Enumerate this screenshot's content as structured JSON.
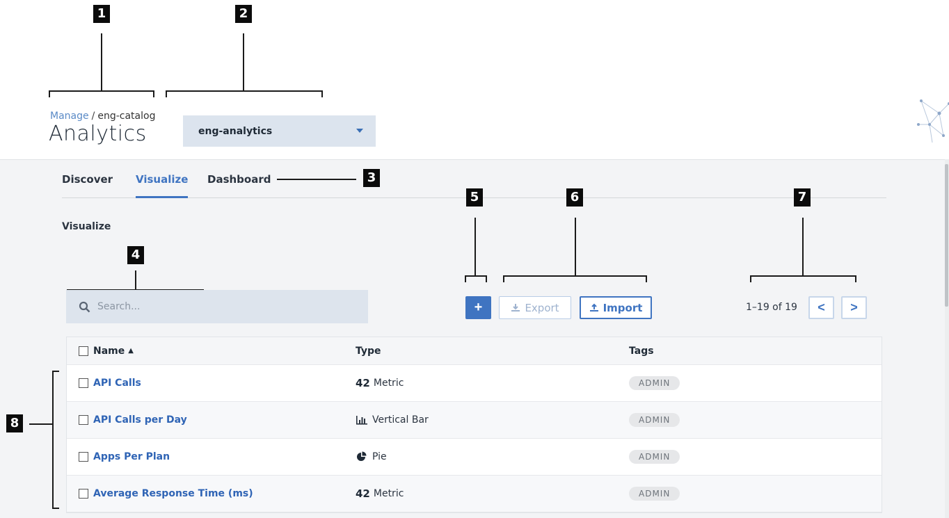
{
  "callouts": [
    "1",
    "2",
    "3",
    "4",
    "5",
    "6",
    "7",
    "8"
  ],
  "header": {
    "breadcrumb_link": "Manage",
    "breadcrumb_sep": "/",
    "breadcrumb_current": "eng-catalog",
    "title": "Analytics",
    "space_selector": "eng-analytics"
  },
  "tabs": [
    {
      "label": "Discover",
      "active": false
    },
    {
      "label": "Visualize",
      "active": true
    },
    {
      "label": "Dashboard",
      "active": false
    }
  ],
  "section_title": "Visualize",
  "search": {
    "placeholder": "Search..."
  },
  "toolbar": {
    "add_label": "+",
    "export_label": "Export",
    "import_label": "Import"
  },
  "pager": {
    "text": "1–19 of 19",
    "prev": "<",
    "next": ">"
  },
  "table": {
    "columns": [
      "Name",
      "Type",
      "Tags"
    ],
    "rows": [
      {
        "name": "API Calls",
        "type_prefix": "42",
        "type": "Metric",
        "icon": "metric-icon",
        "tag": "ADMIN"
      },
      {
        "name": "API Calls per Day",
        "type_prefix": "",
        "type": "Vertical Bar",
        "icon": "vertical-bar-icon",
        "tag": "ADMIN"
      },
      {
        "name": "Apps Per Plan",
        "type_prefix": "",
        "type": "Pie",
        "icon": "pie-icon",
        "tag": "ADMIN"
      },
      {
        "name": "Average Response Time (ms)",
        "type_prefix": "42",
        "type": "Metric",
        "icon": "metric-icon",
        "tag": "ADMIN"
      }
    ]
  },
  "colors": {
    "accent": "#3f74c1",
    "link": "#2f64b5",
    "panel": "#f3f4f6",
    "search_bg": "#dde4ed"
  }
}
